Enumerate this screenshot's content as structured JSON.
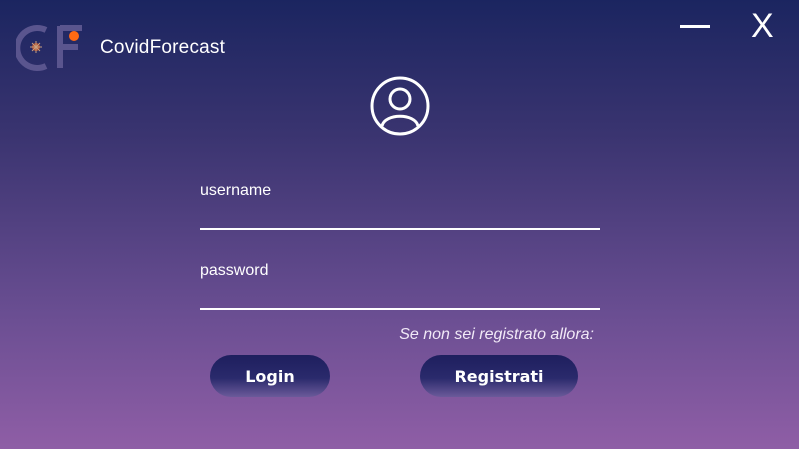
{
  "app": {
    "title": "CovidForecast",
    "logo_text": "CF"
  },
  "window": {
    "close_label": "X"
  },
  "form": {
    "username_label": "username",
    "password_label": "password",
    "username_value": "",
    "password_value": "",
    "hint": "Se non sei registrato allora:"
  },
  "buttons": {
    "login": "Login",
    "register": "Registrati"
  },
  "colors": {
    "accent": "#ff6a13",
    "logo_fill": "#5a558e",
    "button_dark": "#1e1f5e"
  },
  "icons": {
    "avatar": "user-circle-icon",
    "minimize": "minimize-icon",
    "close": "close-icon"
  }
}
